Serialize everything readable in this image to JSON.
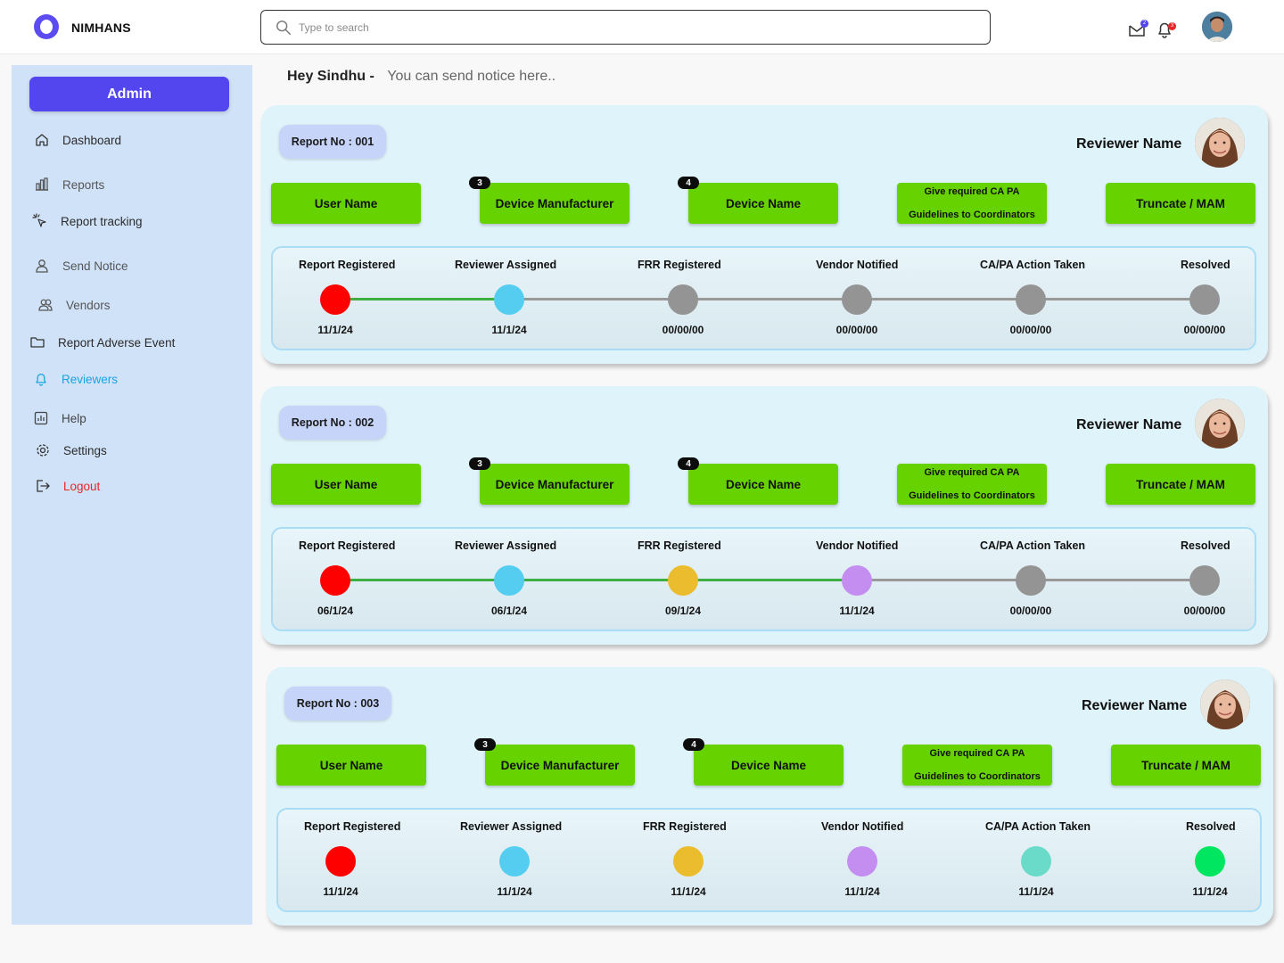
{
  "app": {
    "brand": "NIMHANS"
  },
  "search": {
    "placeholder": "Type to search"
  },
  "header": {
    "mail_count": "2",
    "notif_count": "3"
  },
  "sidebar": {
    "admin_label": "Admin",
    "items": [
      {
        "label": "Dashboard",
        "icon": "home-icon"
      },
      {
        "label": "Reports",
        "icon": "bar-chart-icon"
      },
      {
        "label": "Report tracking",
        "icon": "cursor-click-icon"
      },
      {
        "label": "Send Notice",
        "icon": "user-icon"
      },
      {
        "label": "Vendors",
        "icon": "users-icon"
      },
      {
        "label": "Report Adverse Event",
        "icon": "folder-icon"
      },
      {
        "label": "Reviewers",
        "icon": "bell-icon",
        "active": true
      },
      {
        "label": "Help",
        "icon": "help-chart-icon"
      },
      {
        "label": "Settings",
        "icon": "gear-icon"
      },
      {
        "label": "Logout",
        "icon": "logout-icon"
      }
    ]
  },
  "greeting": {
    "name": "Hey Sindhu  -",
    "message": "You can send notice  here.."
  },
  "colors": {
    "accent": "#5346ef",
    "green_button": "#66d200",
    "done_line": "#3cb043",
    "pending_line": "#999999",
    "pending_dot": "#949494",
    "red": "#ff0000",
    "blue": "#55cdf0",
    "yellow": "#ebbd2e",
    "purple": "#c48ef0",
    "teal": "#6adbc8",
    "green": "#00e660"
  },
  "reports": [
    {
      "report_no": "Report No : 001",
      "reviewer_label": "Reviewer Name",
      "buttons": {
        "user": "User Name",
        "manufacturer": "Device Manufacturer",
        "manufacturer_count": "3",
        "device": "Device Name",
        "device_count": "4",
        "guidelines_line1": "Give required CA PA",
        "guidelines_line2": "Guidelines to Coordinators",
        "truncate": "Truncate / MAM"
      },
      "stages": [
        {
          "label": "Report Registered",
          "date": "11/1/24",
          "color": "#ff0000"
        },
        {
          "label": "Reviewer Assigned",
          "date": "11/1/24",
          "color": "#55cdf0"
        },
        {
          "label": "FRR Registered",
          "date": "00/00/00",
          "color": "#949494"
        },
        {
          "label": "Vendor Notified",
          "date": "00/00/00",
          "color": "#949494"
        },
        {
          "label": "CA/PA Action Taken",
          "date": "00/00/00",
          "color": "#949494"
        },
        {
          "label": "Resolved",
          "date": "00/00/00",
          "color": "#949494"
        }
      ],
      "completed_segments": 1,
      "show_lines": true
    },
    {
      "report_no": "Report No : 002",
      "reviewer_label": "Reviewer Name",
      "buttons": {
        "user": "User Name",
        "manufacturer": "Device Manufacturer",
        "manufacturer_count": "3",
        "device": "Device Name",
        "device_count": "4",
        "guidelines_line1": "Give required CA PA",
        "guidelines_line2": "Guidelines to Coordinators",
        "truncate": "Truncate / MAM"
      },
      "stages": [
        {
          "label": "Report Registered",
          "date": "06/1/24",
          "color": "#ff0000"
        },
        {
          "label": "Reviewer Assigned",
          "date": "06/1/24",
          "color": "#55cdf0"
        },
        {
          "label": "FRR Registered",
          "date": "09/1/24",
          "color": "#ebbd2e"
        },
        {
          "label": "Vendor Notified",
          "date": "11/1/24",
          "color": "#c48ef0"
        },
        {
          "label": "CA/PA Action Taken",
          "date": "00/00/00",
          "color": "#949494"
        },
        {
          "label": "Resolved",
          "date": "00/00/00",
          "color": "#949494"
        }
      ],
      "completed_segments": 3,
      "show_lines": true
    },
    {
      "report_no": "Report No : 003",
      "reviewer_label": "Reviewer Name",
      "buttons": {
        "user": "User Name",
        "manufacturer": "Device Manufacturer",
        "manufacturer_count": "3",
        "device": "Device Name",
        "device_count": "4",
        "guidelines_line1": "Give required CA PA",
        "guidelines_line2": "Guidelines to Coordinators",
        "truncate": "Truncate / MAM"
      },
      "stages": [
        {
          "label": "Report Registered",
          "date": "11/1/24",
          "color": "#ff0000"
        },
        {
          "label": "Reviewer Assigned",
          "date": "11/1/24",
          "color": "#55cdf0"
        },
        {
          "label": "FRR Registered",
          "date": "11/1/24",
          "color": "#ebbd2e"
        },
        {
          "label": "Vendor Notified",
          "date": "11/1/24",
          "color": "#c48ef0"
        },
        {
          "label": "CA/PA Action Taken",
          "date": "11/1/24",
          "color": "#6adbc8"
        },
        {
          "label": "Resolved",
          "date": "11/1/24",
          "color": "#00e660"
        }
      ],
      "completed_segments": 0,
      "show_lines": false
    }
  ]
}
